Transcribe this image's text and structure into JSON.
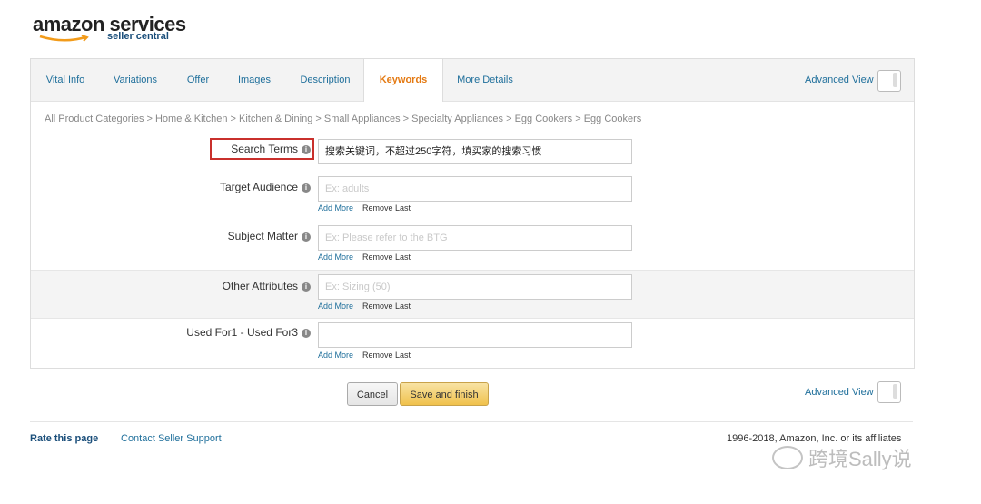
{
  "brand": {
    "name": "amazon services",
    "sub": "seller central"
  },
  "tabs": [
    {
      "label": "Vital Info"
    },
    {
      "label": "Variations"
    },
    {
      "label": "Offer"
    },
    {
      "label": "Images"
    },
    {
      "label": "Description"
    },
    {
      "label": "Keywords",
      "active": true
    },
    {
      "label": "More Details"
    }
  ],
  "advanced_view": "Advanced View",
  "breadcrumb": "All Product Categories > Home & Kitchen > Kitchen & Dining > Small Appliances > Specialty Appliances > Egg Cookers > Egg Cookers",
  "fields": {
    "search_terms": {
      "label": "Search Terms",
      "value": "搜索关键词，不超过250字符，填买家的搜索习惯"
    },
    "target_audience": {
      "label": "Target Audience",
      "placeholder": "Ex: adults"
    },
    "subject_matter": {
      "label": "Subject Matter",
      "placeholder": "Ex: Please refer to the BTG"
    },
    "other_attributes": {
      "label": "Other Attributes",
      "placeholder": "Ex: Sizing (50)"
    },
    "used_for": {
      "label": "Used For1 - Used For3",
      "placeholder": ""
    }
  },
  "add_more": "Add More",
  "remove_last": "Remove Last",
  "info_glyph": "i",
  "buttons": {
    "cancel": "Cancel",
    "save": "Save and finish"
  },
  "footer": {
    "rate": "Rate this page",
    "support": "Contact Seller Support",
    "copyright": "1996-2018, Amazon, Inc. or its affiliates"
  },
  "watermark": "跨境Sally说",
  "colors": {
    "accent": "#e47911",
    "link": "#1f6f9b",
    "highlight": "#c9302c",
    "save_button": "#f0c14b"
  }
}
